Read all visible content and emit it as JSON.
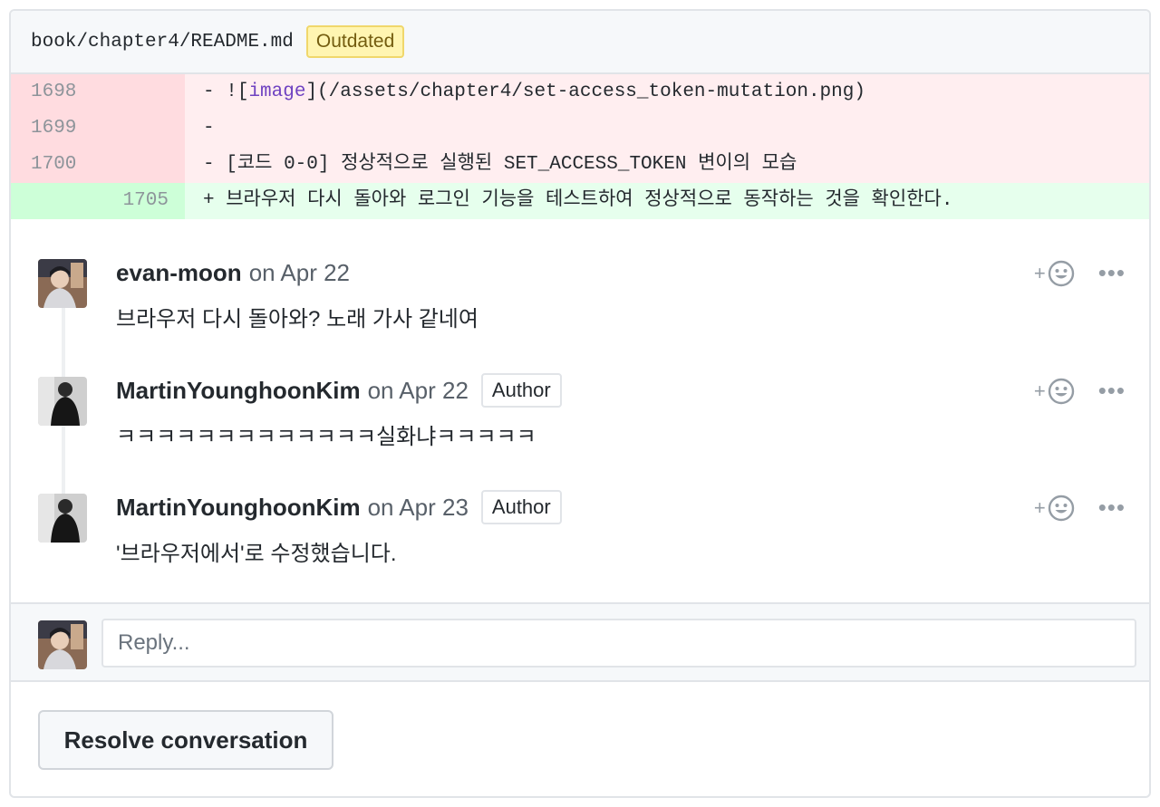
{
  "file_header": {
    "path": "book/chapter4/README.md",
    "status_badge": "Outdated"
  },
  "diff": [
    {
      "type": "deleted",
      "old_number": "1698",
      "new_number": "",
      "prefix": "- ",
      "segments": [
        "![",
        "image",
        "](/assets/chapter4/set-access_token-mutation.png)"
      ]
    },
    {
      "type": "deleted",
      "old_number": "1699",
      "new_number": "",
      "prefix": "-",
      "segments": [
        "",
        "",
        ""
      ]
    },
    {
      "type": "deleted",
      "old_number": "1700",
      "new_number": "",
      "prefix": "- ",
      "segments": [
        "[코드 0-0] 정상적으로 실행된 SET_ACCESS_TOKEN 변이의 모습",
        "",
        ""
      ]
    },
    {
      "type": "added",
      "old_number": "",
      "new_number": "1705",
      "prefix": "+ ",
      "segments": [
        "브라우저 다시 돌아와 로그인 기능을 테스트하여 정상적으로 동작하는 것을 확인한다.",
        "",
        ""
      ]
    }
  ],
  "comments": [
    {
      "author": "evan-moon",
      "date": "on Apr 22",
      "badge": "",
      "body": "브라우저 다시 돌아와? 노래 가사 같네여"
    },
    {
      "author": "MartinYounghoonKim",
      "date": "on Apr 22",
      "badge": "Author",
      "body": "ㅋㅋㅋㅋㅋㅋㅋㅋㅋㅋㅋㅋㅋ실화냐ㅋㅋㅋㅋㅋ"
    },
    {
      "author": "MartinYounghoonKim",
      "date": "on Apr 23",
      "badge": "Author",
      "body": "'브라우저에서'로 수정했습니다."
    }
  ],
  "comment_actions": {
    "add_reaction": "+",
    "more": "•••"
  },
  "reply": {
    "placeholder": "Reply..."
  },
  "resolve_button": {
    "label": "Resolve conversation"
  },
  "colors": {
    "deleted_bg": "#ffeef0",
    "added_bg": "#e6ffed",
    "outdated_bg": "#fff5b1",
    "link_purple": "#6f42c1"
  }
}
